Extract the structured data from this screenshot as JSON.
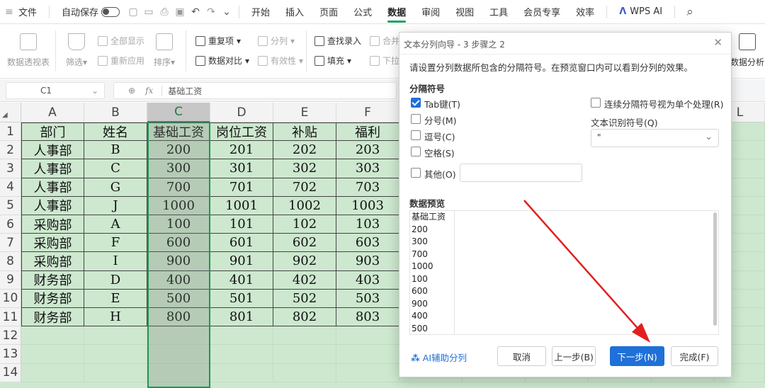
{
  "menubar": {
    "file": "文件",
    "autosave": "自动保存",
    "tabs": [
      "开始",
      "插入",
      "页面",
      "公式",
      "数据",
      "审阅",
      "视图",
      "工具",
      "会员专享",
      "效率"
    ],
    "active_tab": "数据",
    "wps_ai": "WPS AI"
  },
  "ribbon": {
    "pivot": "数据透视表",
    "filter": "筛选",
    "show_all": "全部显示",
    "reapply": "重新应用",
    "sort": "排序",
    "duplicates": "重复项",
    "compare": "数据对比",
    "split": "分列",
    "validity": "有效性",
    "lookup": "查找录入",
    "fill": "填充",
    "merge": "合并",
    "dropdown": "下拉",
    "analysis": "数据分析"
  },
  "formula_bar": {
    "cell_ref": "C1",
    "fx": "fx",
    "content": "基础工资"
  },
  "sheet": {
    "columns": [
      "A",
      "B",
      "C",
      "D",
      "E",
      "F",
      "",
      "L"
    ],
    "rows": [
      "1",
      "2",
      "3",
      "4",
      "5",
      "6",
      "7",
      "8",
      "9",
      "10",
      "11",
      "12",
      "13",
      "14"
    ],
    "header": [
      "部门",
      "姓名",
      "基础工资",
      "岗位工资",
      "补贴",
      "福利"
    ],
    "data": [
      [
        "人事部",
        "B",
        "200",
        "201",
        "202",
        "203"
      ],
      [
        "人事部",
        "C",
        "300",
        "301",
        "302",
        "303"
      ],
      [
        "人事部",
        "G",
        "700",
        "701",
        "702",
        "703"
      ],
      [
        "人事部",
        "J",
        "1000",
        "1001",
        "1002",
        "1003"
      ],
      [
        "采购部",
        "A",
        "100",
        "101",
        "102",
        "103"
      ],
      [
        "采购部",
        "F",
        "600",
        "601",
        "602",
        "603"
      ],
      [
        "采购部",
        "I",
        "900",
        "901",
        "902",
        "903"
      ],
      [
        "财务部",
        "D",
        "400",
        "401",
        "402",
        "403"
      ],
      [
        "财务部",
        "E",
        "500",
        "501",
        "502",
        "503"
      ],
      [
        "财务部",
        "H",
        "800",
        "801",
        "802",
        "803"
      ]
    ]
  },
  "dialog": {
    "title": "文本分列向导 - 3 步骤之 2",
    "description": "请设置分列数据所包含的分隔符号。在预览窗口内可以看到分列的效果。",
    "delimiters_label": "分隔符号",
    "tab": "Tab键(T)",
    "semicolon": "分号(M)",
    "comma": "逗号(C)",
    "space": "空格(S)",
    "other": "其他(O)",
    "other_value": "",
    "consecutive": "连续分隔符号视为单个处理(R)",
    "text_qualifier_label": "文本识别符号(Q)",
    "text_qualifier_value": "\"",
    "preview_label": "数据预览",
    "preview_rows": [
      "基础工资",
      "200",
      "300",
      "700",
      "1000",
      "100",
      "600",
      "900",
      "400",
      "500"
    ],
    "ai_split": "AI辅助分列",
    "cancel": "取消",
    "back": "上一步(B)",
    "next": "下一步(N)",
    "finish": "完成(F)",
    "checked": {
      "tab": true,
      "semicolon": false,
      "comma": false,
      "space": false,
      "other": false,
      "consecutive": false
    }
  },
  "colors": {
    "accent_green": "#1aa260",
    "selection_green": "#1f9850",
    "primary_blue": "#1f70d8",
    "annotation_red": "#e02020"
  }
}
